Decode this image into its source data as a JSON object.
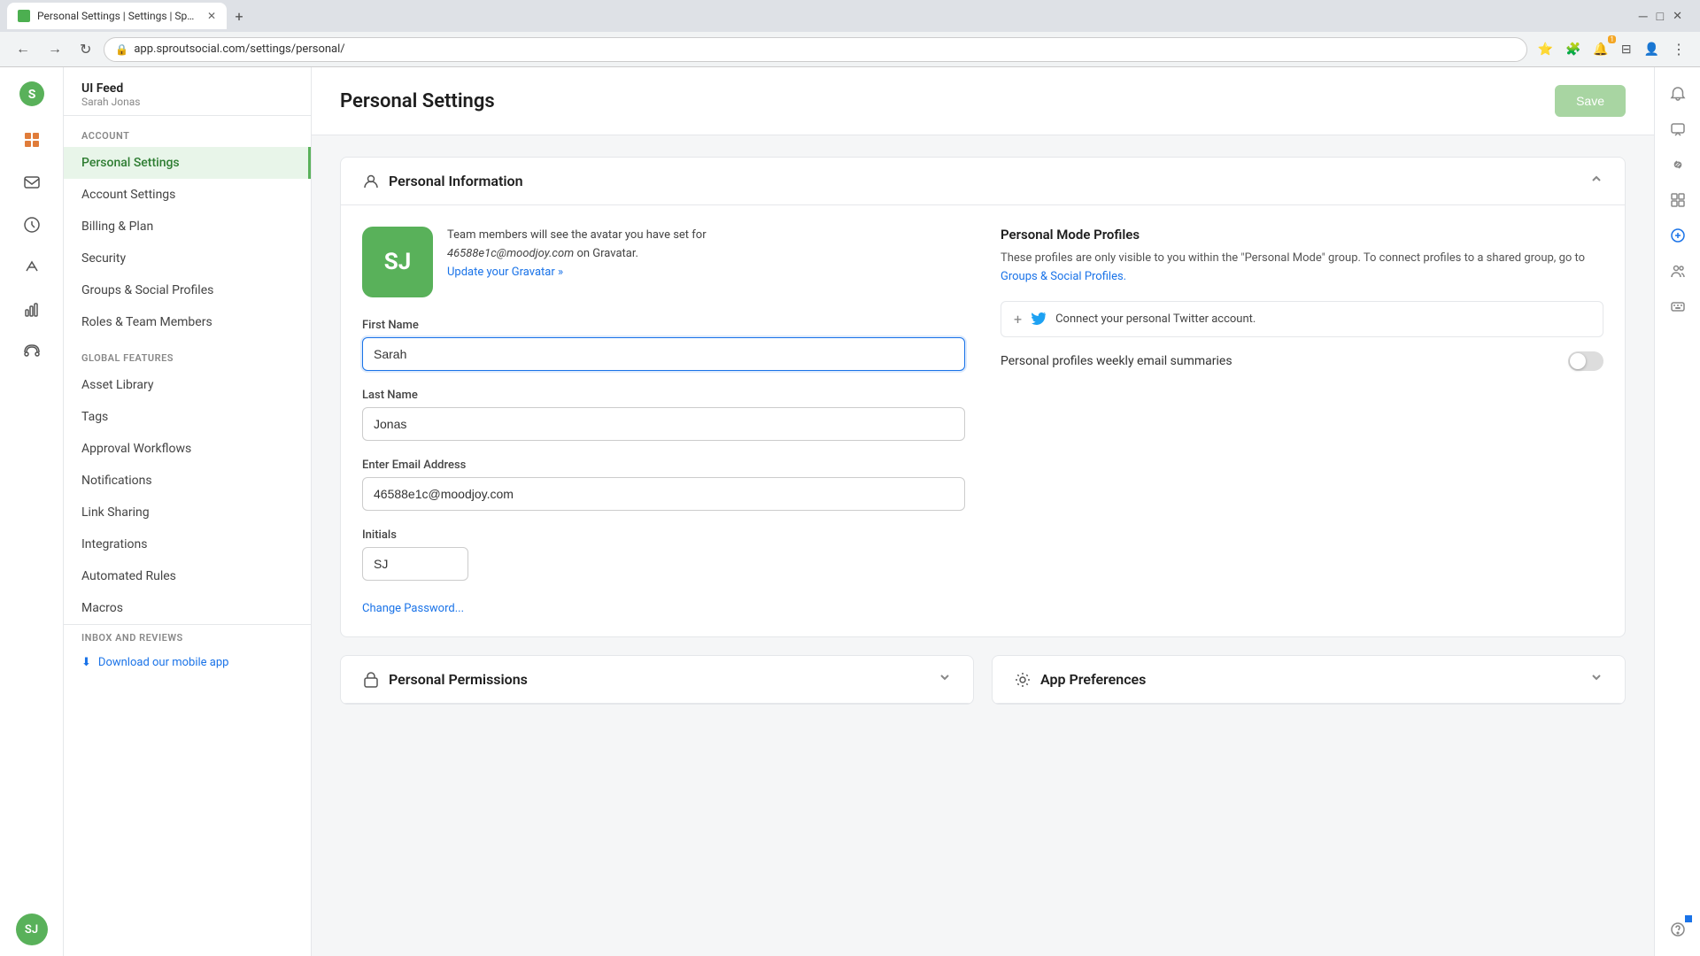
{
  "browser": {
    "tab_title": "Personal Settings | Settings | Spr...",
    "url": "app.sproutsocial.com/settings/personal/",
    "new_tab_label": "+"
  },
  "brand": {
    "logo_symbol": "🌿",
    "app_name": "Sprout Social"
  },
  "user": {
    "name": "UI Feed",
    "subtitle": "Sarah Jonas",
    "avatar_initials": "SJ",
    "avatar_color": "#59b15a"
  },
  "nav": {
    "account_section": "Account",
    "items_account": [
      {
        "label": "Personal Settings",
        "active": true,
        "id": "personal-settings"
      },
      {
        "label": "Account Settings",
        "id": "account-settings"
      },
      {
        "label": "Billing & Plan",
        "id": "billing-plan"
      },
      {
        "label": "Security",
        "id": "security"
      },
      {
        "label": "Groups & Social Profiles",
        "id": "groups-social"
      },
      {
        "label": "Roles & Team Members",
        "id": "roles-team"
      }
    ],
    "global_section": "Global Features",
    "items_global": [
      {
        "label": "Asset Library",
        "id": "asset-library"
      },
      {
        "label": "Tags",
        "id": "tags"
      },
      {
        "label": "Approval Workflows",
        "id": "approval-workflows"
      },
      {
        "label": "Notifications",
        "id": "notifications"
      },
      {
        "label": "Link Sharing",
        "id": "link-sharing"
      },
      {
        "label": "Integrations",
        "id": "integrations"
      },
      {
        "label": "Automated Rules",
        "id": "automated-rules"
      },
      {
        "label": "Macros",
        "id": "macros"
      }
    ],
    "inbox_section": "Inbox and Reviews",
    "download_link": "Download our mobile app"
  },
  "page": {
    "title": "Personal Settings",
    "save_button": "Save"
  },
  "personal_info": {
    "section_title": "Personal Information",
    "avatar_text": "Team members will see the avatar you have set for",
    "avatar_email": "46588e1c@moodjoy.com",
    "avatar_email2": " on Gravatar.",
    "gravatar_link": "Update your Gravatar »",
    "first_name_label": "First Name",
    "first_name_value": "Sarah",
    "last_name_label": "Last Name",
    "last_name_value": "Jonas",
    "email_label": "Enter Email Address",
    "email_value": "46588e1c@moodjoy.com",
    "initials_label": "Initials",
    "initials_value": "SJ",
    "change_password": "Change Password...",
    "personal_mode_title": "Personal Mode Profiles",
    "personal_mode_desc_1": "These profiles are only visible to you within the \"Personal Mode\" group. To connect profiles to a shared group, go to ",
    "personal_mode_link": "Groups & Social Profiles.",
    "connect_twitter": "Connect your personal Twitter account.",
    "weekly_email_label": "Personal profiles weekly email summaries",
    "toggle_state": false
  },
  "personal_permissions": {
    "section_title": "Personal Permissions"
  },
  "app_preferences": {
    "section_title": "App Preferences"
  },
  "icons": {
    "brand": "●",
    "feed": "≡",
    "inbox": "✉",
    "bell": "🔔",
    "link": "🔗",
    "grid": "⊞",
    "compose": "✏",
    "people": "👥",
    "keyboard": "⌨",
    "help": "?",
    "person": "👤",
    "chart_bar": "📊",
    "chart_line": "📈",
    "chevron_up": "▲",
    "chevron_down": "▼",
    "download": "⬇",
    "twitter_blue": "#1da1f2",
    "plus": "+"
  }
}
